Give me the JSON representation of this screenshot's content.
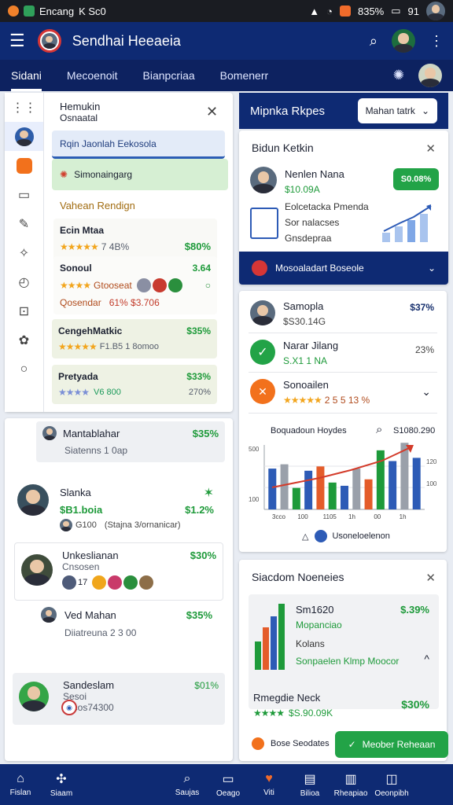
{
  "status": {
    "carrier": "Encang",
    "extra": "K Sc0",
    "battery": "835%",
    "time_right": "91"
  },
  "app": {
    "title": "Sendhai Heeaeia"
  },
  "tabs": [
    {
      "label": "Sidani"
    },
    {
      "label": "Mecoenoit"
    },
    {
      "label": "Bianpcriaa"
    },
    {
      "label": "Bomenerr"
    }
  ],
  "drawer": {
    "title": "Hemukin",
    "subtitle": "Osnaatal",
    "item1": "Rqin Jaonlah Eekosola",
    "item2": "Simonaingarg",
    "section": "Vahean Rendign",
    "entries": [
      {
        "name": "Ecin Mtaa",
        "sub": "7 4B%",
        "value": "$80%"
      },
      {
        "name": "Sonoul",
        "sub": "Gtooseat",
        "value": "3.64",
        "sub2": "Qosendar",
        "sub3": "61% $3.706"
      },
      {
        "name": "CengehMatkic",
        "sub": "F1.B5 1 8omoo",
        "value": "$35%"
      },
      {
        "name": "Pretyada",
        "sub": "V6   800",
        "value": "$33%",
        "sub2": "270%"
      }
    ]
  },
  "feed": [
    {
      "name": "Mantablahar",
      "sub": "Siatenns 1 0ap",
      "value": "$35%"
    },
    {
      "name": "Slanka",
      "sub": "$B1.boia",
      "value": "$1.2%",
      "note": "(Stajna 3/ornanicar)",
      "count": "G100"
    },
    {
      "name": "Unkeslianan",
      "sub": "Cnsosen",
      "value": "$30%",
      "count": "17"
    },
    {
      "name": "Ved Mahan",
      "sub": "Diiatreuna 2 3 00",
      "value": "$35%"
    },
    {
      "name": "Sandeslam",
      "sub": "Sesoi",
      "value": "$01%",
      "sub2": "Otcos74300"
    }
  ],
  "right": {
    "header": "Mipnka Rkpes",
    "filter": "Mahan tatrk",
    "card1": {
      "title": "Bidun Ketkin",
      "person": "Nenlen Nana",
      "money": "$10.09A",
      "badge": "S0.08%",
      "lines": [
        "Eolcetacka Pmenda",
        "Sor nalacses",
        "Gnsdepraa"
      ],
      "footer": "Mosoaladart Boseole"
    },
    "card2": {
      "rows": [
        {
          "name": "Samopla",
          "sub": "$S30.14G",
          "value": "$37%"
        },
        {
          "name": "Narar Jilang",
          "sub": "S.X1 1 NA",
          "value": "23%"
        },
        {
          "name": "Sonoailen",
          "sub": "2 5 5 13 %",
          "value": ""
        }
      ],
      "chart_header": "Boquadoun Hoydes",
      "chart_value": "S1080.290",
      "legend": "Usoneloelenon"
    },
    "card3": {
      "title": "Siacdom Noeneies",
      "amount": "Sm1620",
      "value": "$.39%",
      "green_label": "Mopanciao",
      "label": "Kolans",
      "green_text": "Sonpaelen Klmp Moocor",
      "caption": "Rmegdie Neck",
      "stars_value": "$S.90.09K",
      "value2": "$30%",
      "button": "Meober Reheaan",
      "side_label": "Bose Seodates"
    }
  },
  "bottom_nav": [
    {
      "label": "Fislan"
    },
    {
      "label": "Siaam"
    },
    {
      "label": ""
    },
    {
      "label": "Saujas"
    },
    {
      "label": "Oeago"
    },
    {
      "label": "Viti"
    },
    {
      "label": "Bilioa"
    },
    {
      "label": "Rheapiao"
    },
    {
      "label": "Oeonpibh"
    }
  ],
  "chart_data": {
    "type": "bar",
    "title": "Boquadoun Hoydes",
    "categories": [
      "3cco",
      "100",
      "1105",
      "1h",
      "00",
      "1h"
    ],
    "series": [
      {
        "values": [
          38,
          42,
          20,
          36,
          40,
          25,
          22,
          38,
          28,
          55,
          45,
          62,
          48
        ]
      }
    ],
    "ylim": [
      0,
      60
    ],
    "ytick_labels": [
      "500",
      "100"
    ],
    "right_tick_labels": [
      "120",
      "100"
    ]
  }
}
